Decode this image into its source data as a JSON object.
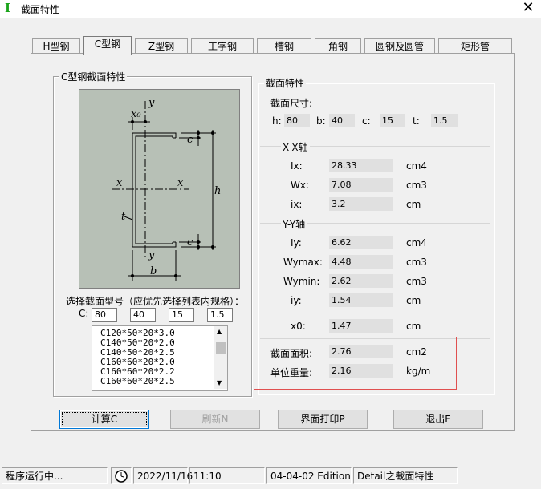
{
  "window": {
    "title": "截面特性",
    "close_glyph": "✕",
    "app_icon_glyph": "I"
  },
  "tabs": [
    {
      "label": "H型钢"
    },
    {
      "label": "C型钢"
    },
    {
      "label": "Z型钢"
    },
    {
      "label": "工字钢"
    },
    {
      "label": "槽钢"
    },
    {
      "label": "角钢"
    },
    {
      "label": "圆钢及圆管"
    },
    {
      "label": "矩形管"
    }
  ],
  "left_group": {
    "title": "C型钢截面特性",
    "diagram": {
      "labels": {
        "x0": "x₀",
        "y_top": "y",
        "c_top": "c",
        "x_left": "x",
        "x_right": "x",
        "h": "h",
        "t": "t",
        "c_bottom": "c",
        "y_bottom": "y",
        "b": "b"
      }
    },
    "select_caption": "选择截面型号（应优先选择列表内规格）：",
    "c_label": "C:",
    "inputs": [
      "80",
      "40",
      "15",
      "1.5"
    ],
    "list_items": [
      "C120*50*20*3.0",
      "C140*50*20*2.0",
      "C140*50*20*2.5",
      "C160*60*20*2.0",
      "C160*60*20*2.2",
      "C160*60*20*2.5"
    ]
  },
  "right_group": {
    "title": "截面特性",
    "size_caption": "截面尺寸:",
    "dims": [
      {
        "label": "h:",
        "value": "80"
      },
      {
        "label": "b:",
        "value": "40"
      },
      {
        "label": "c:",
        "value": "15"
      },
      {
        "label": "t:",
        "value": "1.5"
      }
    ],
    "xx_title": "X-X轴",
    "xx": [
      {
        "label": "Ix:",
        "value": "28.33",
        "unit": "cm4"
      },
      {
        "label": "Wx:",
        "value": "7.08",
        "unit": "cm3"
      },
      {
        "label": "ix:",
        "value": "3.2",
        "unit": "cm"
      }
    ],
    "yy_title": "Y-Y轴",
    "yy": [
      {
        "label": "Iy:",
        "value": "6.62",
        "unit": "cm4"
      },
      {
        "label": "Wymax:",
        "value": "4.48",
        "unit": "cm3"
      },
      {
        "label": "Wymin:",
        "value": "2.62",
        "unit": "cm3"
      },
      {
        "label": "iy:",
        "value": "1.54",
        "unit": "cm"
      }
    ],
    "x0": {
      "label": "x0:",
      "value": "1.47",
      "unit": "cm"
    },
    "area": {
      "label": "截面面积:",
      "value": "2.76",
      "unit": "cm2"
    },
    "weight": {
      "label": "单位重量:",
      "value": "2.16",
      "unit": "kg/m"
    }
  },
  "buttons": {
    "calc": "计算C",
    "refresh": "刷新N",
    "print": "界面打印P",
    "exit": "退出E"
  },
  "status": {
    "running": "程序运行中...",
    "date": "2022/11/16",
    "time": "11:10",
    "edition": "04-04-02 Edition",
    "detail": "Detail之截面特性"
  },
  "colors": {
    "diagram_bg": "#b7c0b6",
    "highlight": "#e05050",
    "icon": "#1aa31a"
  }
}
